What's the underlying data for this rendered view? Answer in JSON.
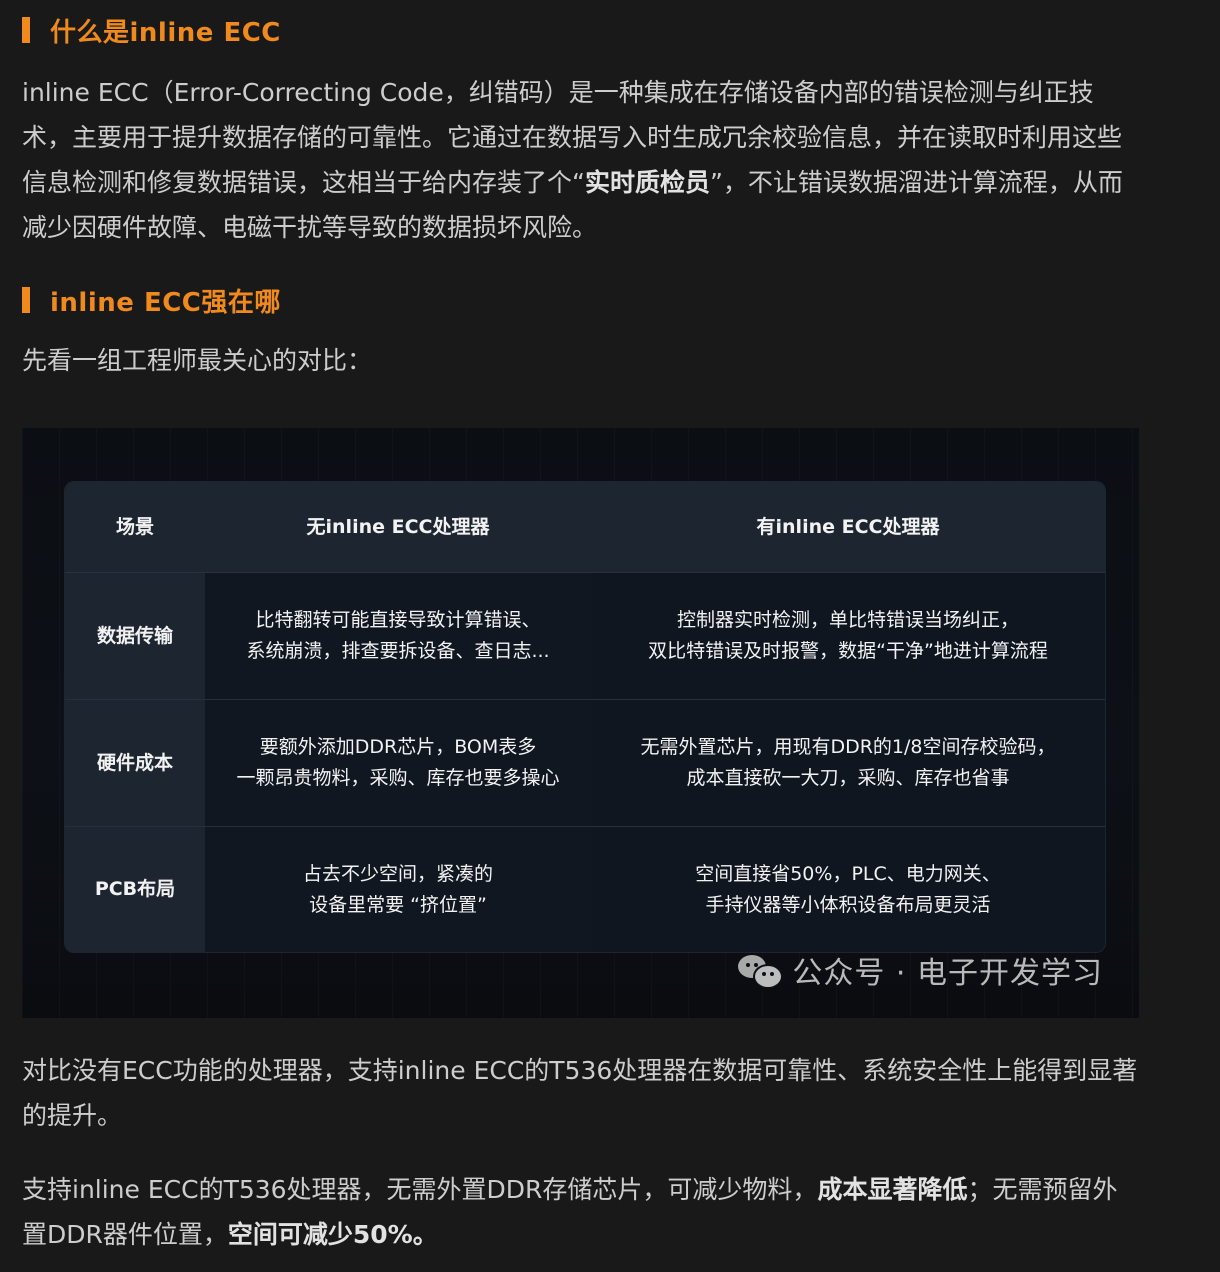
{
  "section1": {
    "heading": "什么是inline ECC",
    "paragraph": [
      {
        "text": "inline ECC（Error-Correcting Code，纠错码）是一种集成在存储设备内部的错误检测与纠正技术，主要用于提升数据存储的可靠性。它通过在数据写入时生成冗余校验信息，并在读取时利用这些信息检测和修复数据错误，这相当于给内存装了个“",
        "bold": false
      },
      {
        "text": "实时质检员",
        "bold": true
      },
      {
        "text": "”，不让错误数据溜进计算流程，从而减少因硬件故障、电磁干扰等导致的数据损坏风险。",
        "bold": false
      }
    ]
  },
  "section2": {
    "heading": "inline ECC强在哪",
    "intro": "先看一组工程师最关心的对比："
  },
  "comparison_table": {
    "headers": [
      "场景",
      "无inline ECC处理器",
      "有inline ECC处理器"
    ],
    "rows": [
      {
        "scene": "数据传输",
        "without": [
          "比特翻转可能直接导致计算错误、",
          "系统崩溃，排查要拆设备、查日志..."
        ],
        "with": [
          "控制器实时检测，单比特错误当场纠正，",
          "双比特错误及时报警，数据“干净”地进计算流程"
        ]
      },
      {
        "scene": "硬件成本",
        "without": [
          "要额外添加DDR芯片，BOM表多",
          "一颗昂贵物料，采购、库存也要多操心"
        ],
        "with": [
          "无需外置芯片，用现有DDR的1/8空间存校验码，",
          "成本直接砍一大刀，采购、库存也省事"
        ]
      },
      {
        "scene": "PCB布局",
        "without": [
          "占去不少空间，紧凑的",
          "设备里常要 “挤位置”"
        ],
        "with": [
          "空间直接省50%，PLC、电力网关、",
          "手持仪器等小体积设备布局更灵活"
        ]
      }
    ],
    "watermark": "公众号 · 电子开发学习"
  },
  "paragraph3": "对比没有ECC功能的处理器，支持inline ECC的T536处理器在数据可靠性、系统安全性上能得到显著的提升。",
  "paragraph4": [
    {
      "text": "支持inline ECC的T536处理器，无需外置DDR存储芯片，可减少物料，",
      "bold": false
    },
    {
      "text": "成本显著降低",
      "bold": true
    },
    {
      "text": "；无需预留外置DDR器件位置，",
      "bold": false
    },
    {
      "text": "空间可减少50%。",
      "bold": true
    }
  ],
  "colors": {
    "heading_accent": "#f08a1c",
    "page_background": "#191919",
    "body_text": "#cdcdcd"
  }
}
